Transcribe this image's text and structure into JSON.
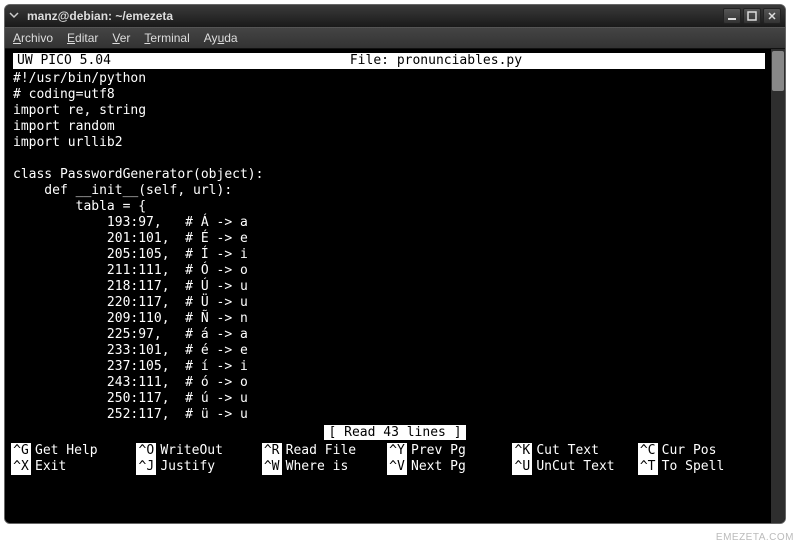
{
  "window": {
    "title": "manz@debian: ~/emezeta"
  },
  "menubar": [
    "Archivo",
    "Editar",
    "Ver",
    "Terminal",
    "Ayuda"
  ],
  "editor": {
    "program": "UW PICO 5.04",
    "file_label": "File: pronunciables.py",
    "status": "[ Read 43 lines ]",
    "code": "#!/usr/bin/python\n# coding=utf8\nimport re, string\nimport random\nimport urllib2\n\nclass PasswordGenerator(object):\n    def __init__(self, url):\n        tabla = {\n            193:97,   # Á -> a\n            201:101,  # É -> e\n            205:105,  # Í -> i\n            211:111,  # Ó -> o\n            218:117,  # Ú -> u\n            220:117,  # Ü -> u\n            209:110,  # Ñ -> n\n            225:97,   # á -> a\n            233:101,  # é -> e\n            237:105,  # í -> i\n            243:111,  # ó -> o\n            250:117,  # ú -> u\n            252:117,  # ü -> u"
  },
  "shortcuts": {
    "row1": [
      {
        "key": "^G",
        "label": "Get Help"
      },
      {
        "key": "^O",
        "label": "WriteOut"
      },
      {
        "key": "^R",
        "label": "Read File"
      },
      {
        "key": "^Y",
        "label": "Prev Pg"
      },
      {
        "key": "^K",
        "label": "Cut Text"
      },
      {
        "key": "^C",
        "label": "Cur Pos"
      }
    ],
    "row2": [
      {
        "key": "^X",
        "label": "Exit"
      },
      {
        "key": "^J",
        "label": "Justify"
      },
      {
        "key": "^W",
        "label": "Where is"
      },
      {
        "key": "^V",
        "label": "Next Pg"
      },
      {
        "key": "^U",
        "label": "UnCut Text"
      },
      {
        "key": "^T",
        "label": "To Spell"
      }
    ]
  },
  "watermark": "EMEZETA.COM"
}
